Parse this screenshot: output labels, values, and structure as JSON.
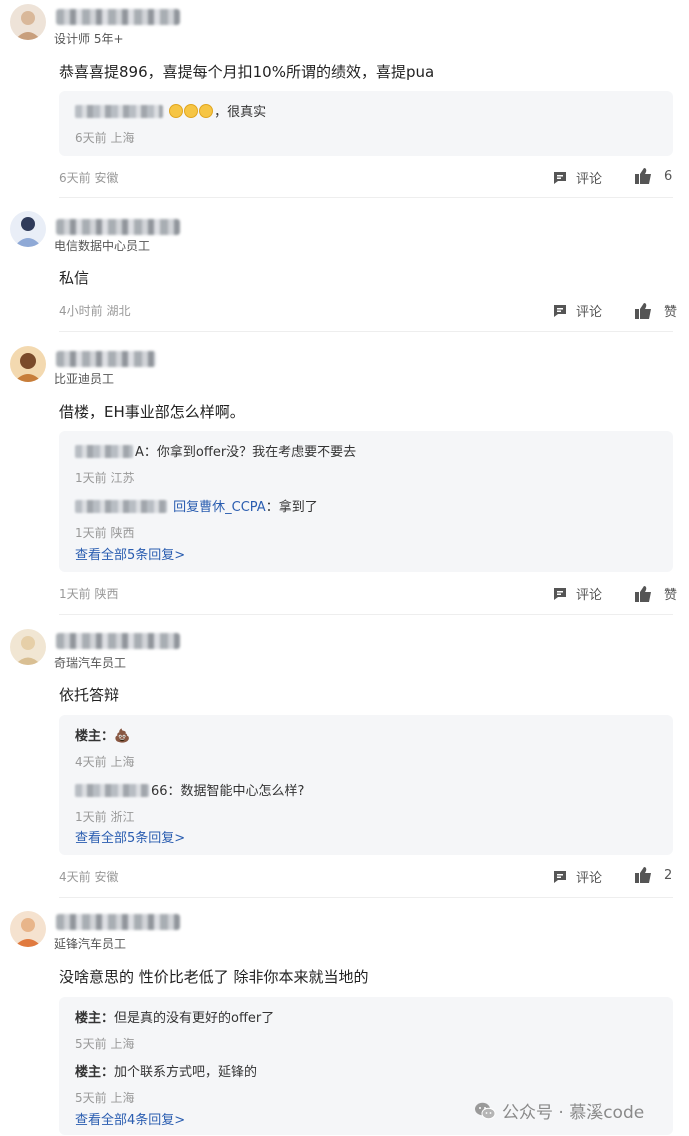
{
  "comments": [
    {
      "role": "设计师 5年+",
      "content": "恭喜喜提896，喜提每个月扣10%所谓的绩效，喜提pua",
      "replies": [
        {
          "text": "，很真实",
          "meta": "6天前 上海"
        }
      ],
      "meta": "6天前 安徽",
      "comment_label": "评论",
      "like_label": "6"
    },
    {
      "role": "电信数据中心员工",
      "content": "私信",
      "meta": "4小时前 湖北",
      "comment_label": "评论",
      "like_label": "赞"
    },
    {
      "role": "比亚迪员工",
      "content": "借楼，EH事业部怎么样啊。",
      "replies": [
        {
          "prefix": "A：",
          "text": "你拿到offer没？我在考虑要不要去",
          "meta": "1天前 江苏"
        },
        {
          "reply_to": "回复曹休_CCPA",
          "text": "：拿到了",
          "meta": "1天前 陕西"
        }
      ],
      "more": "查看全部5条回复>",
      "meta": "1天前 陕西",
      "comment_label": "评论",
      "like_label": "赞"
    },
    {
      "role": "奇瑞汽车员工",
      "content": "依托答辩",
      "replies": [
        {
          "author": "楼主：",
          "text": "💩",
          "meta": "4天前 上海"
        },
        {
          "prefix": "66：",
          "text": "数据智能中心怎么样?",
          "meta": "1天前 浙江"
        }
      ],
      "more": "查看全部5条回复>",
      "meta": "4天前 安徽",
      "comment_label": "评论",
      "like_label": "2"
    },
    {
      "role": "延锋汽车员工",
      "content": "没啥意思的 性价比老低了 除非你本来就当地的",
      "replies": [
        {
          "author": "楼主：",
          "text": "但是真的没有更好的offer了",
          "meta": "5天前 上海"
        },
        {
          "author": "楼主：",
          "text": "加个联系方式吧，延锋的",
          "meta": "5天前 上海"
        }
      ],
      "more": "查看全部4条回复>"
    }
  ],
  "watermark": {
    "text": "公众号 · 慕溪code",
    "icon": "wechat-icon"
  },
  "colors": {
    "link": "#2a5db0",
    "reply_bg": "#f5f6f8",
    "meta": "#999999"
  }
}
